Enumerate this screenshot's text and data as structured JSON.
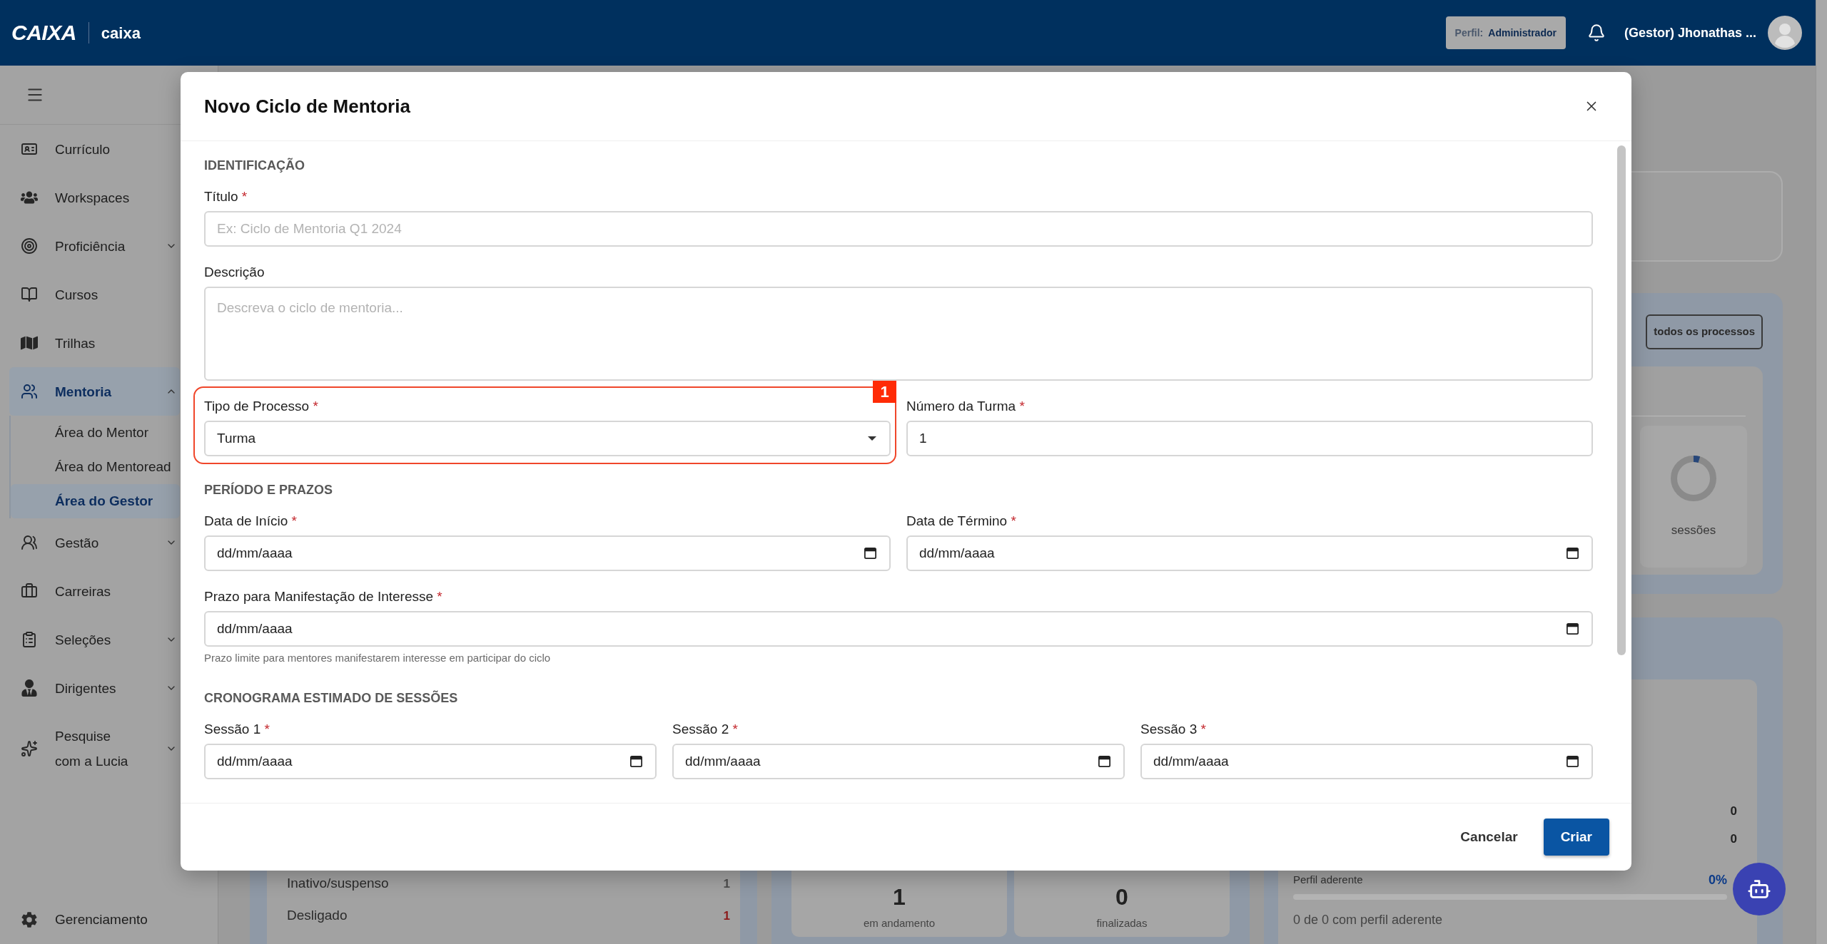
{
  "header": {
    "logo": "CAIXA",
    "app_name": "caixa",
    "profile_label": "Perfil:",
    "profile_value": "Administrador",
    "user_name": "(Gestor) Jhonathas ..."
  },
  "sidebar": {
    "items": [
      {
        "label": "Currículo",
        "selected": false
      },
      {
        "label": "Workspaces",
        "selected": false
      },
      {
        "label": "Proficiência",
        "selected": false,
        "expanded": false
      },
      {
        "label": "Cursos",
        "selected": false
      },
      {
        "label": "Trilhas",
        "selected": false
      },
      {
        "label": "Mentoria",
        "selected": true,
        "expanded": true,
        "children": [
          {
            "label": "Área do Mentor",
            "selected": false
          },
          {
            "label": "Área do Mentoread",
            "selected": false
          },
          {
            "label": "Área do Gestor",
            "selected": true
          }
        ]
      },
      {
        "label": "Gestão",
        "selected": false,
        "expanded": false
      },
      {
        "label": "Carreiras",
        "selected": false
      },
      {
        "label": "Seleções",
        "selected": false,
        "expanded": false
      },
      {
        "label": "Dirigentes",
        "selected": false,
        "expanded": false
      },
      {
        "label": "Pesquise com a Lucia",
        "selected": false,
        "expanded": false
      }
    ],
    "footer_item": {
      "label": "Gerenciamento"
    }
  },
  "dashboard": {
    "top_panel": {
      "button": "todos os processos",
      "chart_caption": "sessões"
    },
    "status_rows": [
      {
        "label": "Inativo/suspenso",
        "value": "1",
        "color": "#4d4d4d"
      },
      {
        "label": "Desligado",
        "value": "1",
        "color": "#8c1a1a"
      }
    ],
    "cycle_counts": [
      {
        "value": "1",
        "label": "em andamento"
      },
      {
        "value": "0",
        "label": "finalizadas"
      }
    ],
    "summary": {
      "values": [
        "0",
        "0"
      ],
      "match_label": "Perfil aderente",
      "match_percent": "0%",
      "level": 0,
      "match_caption": "0 de 0 com perfil aderente"
    }
  },
  "dialog": {
    "title": "Novo Ciclo de Mentoria",
    "sections": [
      {
        "heading": "IDENTIFICAÇÃO",
        "rows": [
          [
            {
              "kind": "text",
              "label": "Título",
              "required_mark": "*",
              "placeholder": "Ex: Ciclo de Mentoria Q1 2024"
            }
          ],
          [
            {
              "kind": "textarea",
              "label": "Descrição",
              "placeholder": "Descreva o ciclo de mentoria..."
            }
          ],
          [
            {
              "kind": "select",
              "label": "Tipo de Processo",
              "required_mark": "*",
              "value": "Turma",
              "annotation": "1"
            },
            {
              "kind": "text",
              "label": "Número da Turma",
              "required_mark": "*",
              "value": "1"
            }
          ]
        ]
      },
      {
        "heading": "PERÍODO E PRAZOS",
        "rows": [
          [
            {
              "kind": "date",
              "label": "Data de Início",
              "required_mark": "*",
              "placeholder": "dd/mm/aaaa"
            },
            {
              "kind": "date",
              "label": "Data de Término",
              "required_mark": "*",
              "placeholder": "dd/mm/aaaa"
            }
          ],
          [
            {
              "kind": "date",
              "label": "Prazo para Manifestação de Interesse",
              "required_mark": "*",
              "placeholder": "dd/mm/aaaa",
              "hint": "Prazo limite para mentores manifestarem interesse em participar do ciclo"
            }
          ]
        ]
      },
      {
        "heading": "CRONOGRAMA ESTIMADO DE SESSÕES",
        "rows": [
          [
            {
              "kind": "date",
              "label": "Sessão 1",
              "required_mark": "*",
              "placeholder": "dd/mm/aaaa"
            },
            {
              "kind": "date",
              "label": "Sessão 2",
              "required_mark": "*",
              "placeholder": "dd/mm/aaaa"
            },
            {
              "kind": "date",
              "label": "Sessão 3",
              "required_mark": "*",
              "placeholder": "dd/mm/aaaa"
            }
          ]
        ]
      }
    ],
    "buttons": [
      {
        "kind": "text",
        "label": "Cancelar"
      },
      {
        "kind": "primary",
        "label": "Criar"
      }
    ]
  }
}
